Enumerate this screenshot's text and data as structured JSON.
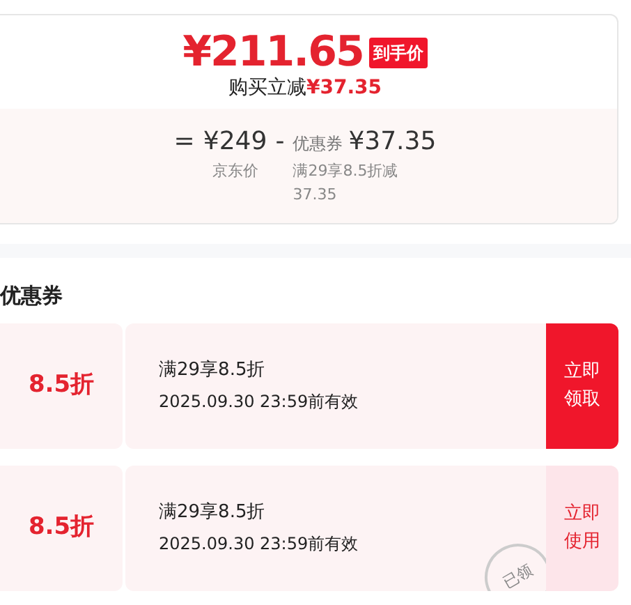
{
  "price_card": {
    "final_price": "¥211.65",
    "final_tag": "到手价",
    "saving_label": "购买立减",
    "saving_amount": "¥37.35",
    "breakdown": {
      "equals": "=",
      "base_price": "¥249",
      "base_label": "京东价",
      "minus": "-",
      "coupon_prefix": "优惠券",
      "coupon_amount": "¥37.35",
      "coupon_label": "满29享8.5折减37.35"
    }
  },
  "coupon_section": {
    "title": "优惠券",
    "coupons": [
      {
        "discount": "8.5折",
        "rule": "满29享8.5折",
        "validity": "2025.09.30 23:59前有效",
        "action": "立即领取",
        "claimed": false
      },
      {
        "discount": "8.5折",
        "rule": "满29享8.5折",
        "validity": "2025.09.30 23:59前有效",
        "action": "立即使用",
        "claimed": true,
        "stamp": "已领"
      }
    ]
  }
}
